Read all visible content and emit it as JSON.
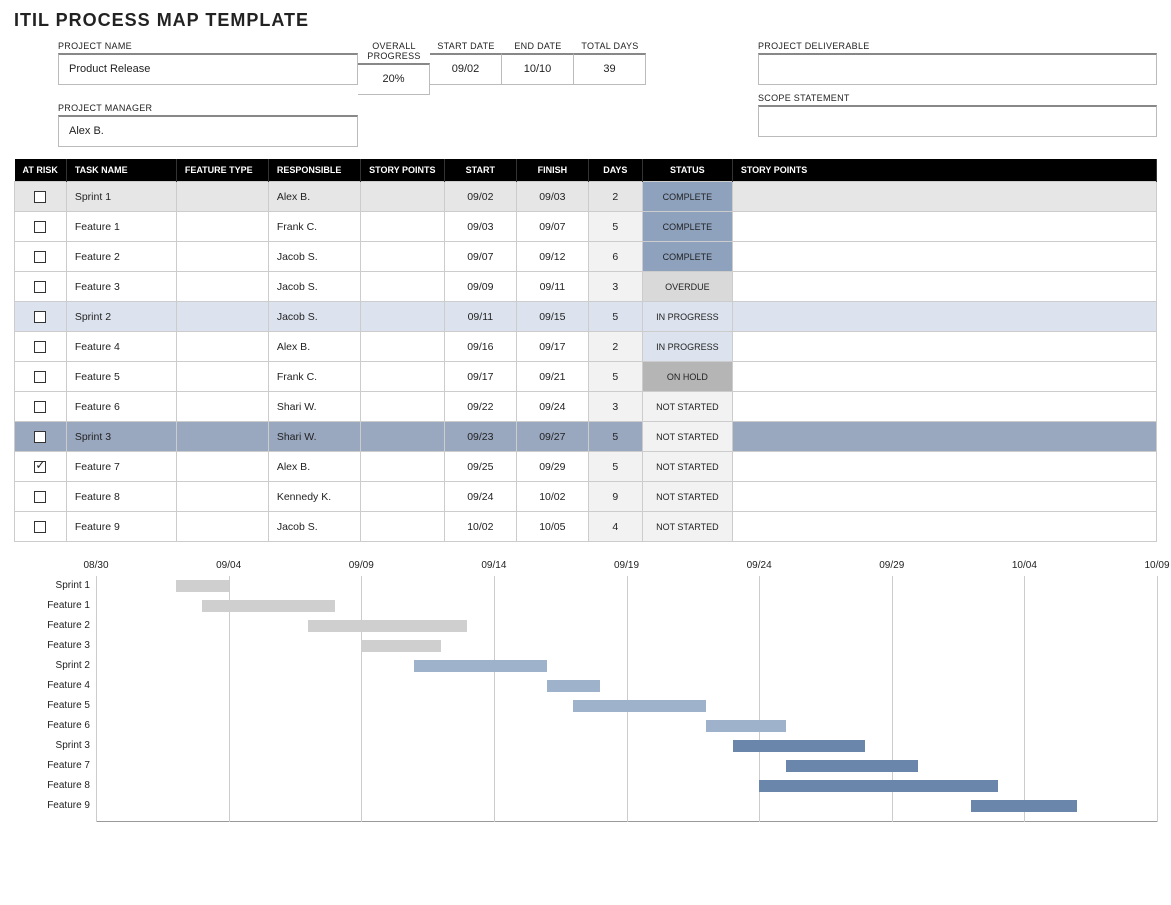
{
  "title": "ITIL PROCESS MAP TEMPLATE",
  "labels": {
    "project_name": "PROJECT NAME",
    "overall_progress": "OVERALL PROGRESS",
    "start_date": "START DATE",
    "end_date": "END DATE",
    "total_days": "TOTAL DAYS",
    "project_manager": "PROJECT MANAGER",
    "project_deliverable": "PROJECT DELIVERABLE",
    "scope_statement": "SCOPE STATEMENT"
  },
  "project": {
    "name": "Product Release",
    "overall_progress": "20%",
    "start_date": "09/02",
    "end_date": "10/10",
    "total_days": "39",
    "manager": "Alex B.",
    "deliverable": "",
    "scope": ""
  },
  "columns": {
    "at_risk": "AT RISK",
    "task_name": "TASK NAME",
    "feature_type": "FEATURE TYPE",
    "responsible": "RESPONSIBLE",
    "story_points": "STORY POINTS",
    "start": "START",
    "finish": "FINISH",
    "days": "DAYS",
    "status": "STATUS",
    "story_points2": "STORY POINTS"
  },
  "rows": [
    {
      "risk": false,
      "task": "Sprint 1",
      "ft": "",
      "resp": "Alex B.",
      "sp": "",
      "start": "09/02",
      "finish": "09/03",
      "days": "2",
      "status": "COMPLETE",
      "rowclass": "sprint1"
    },
    {
      "risk": false,
      "task": "Feature 1",
      "ft": "",
      "resp": "Frank C.",
      "sp": "",
      "start": "09/03",
      "finish": "09/07",
      "days": "5",
      "status": "COMPLETE",
      "rowclass": ""
    },
    {
      "risk": false,
      "task": "Feature 2",
      "ft": "",
      "resp": "Jacob S.",
      "sp": "",
      "start": "09/07",
      "finish": "09/12",
      "days": "6",
      "status": "COMPLETE",
      "rowclass": ""
    },
    {
      "risk": false,
      "task": "Feature 3",
      "ft": "",
      "resp": "Jacob S.",
      "sp": "",
      "start": "09/09",
      "finish": "09/11",
      "days": "3",
      "status": "OVERDUE",
      "rowclass": ""
    },
    {
      "risk": false,
      "task": "Sprint 2",
      "ft": "",
      "resp": "Jacob S.",
      "sp": "",
      "start": "09/11",
      "finish": "09/15",
      "days": "5",
      "status": "IN PROGRESS",
      "rowclass": "sprint2"
    },
    {
      "risk": false,
      "task": "Feature 4",
      "ft": "",
      "resp": "Alex B.",
      "sp": "",
      "start": "09/16",
      "finish": "09/17",
      "days": "2",
      "status": "IN PROGRESS",
      "rowclass": ""
    },
    {
      "risk": false,
      "task": "Feature 5",
      "ft": "",
      "resp": "Frank C.",
      "sp": "",
      "start": "09/17",
      "finish": "09/21",
      "days": "5",
      "status": "ON HOLD",
      "rowclass": ""
    },
    {
      "risk": false,
      "task": "Feature 6",
      "ft": "",
      "resp": "Shari W.",
      "sp": "",
      "start": "09/22",
      "finish": "09/24",
      "days": "3",
      "status": "NOT STARTED",
      "rowclass": ""
    },
    {
      "risk": false,
      "task": "Sprint 3",
      "ft": "",
      "resp": "Shari W.",
      "sp": "",
      "start": "09/23",
      "finish": "09/27",
      "days": "5",
      "status": "NOT STARTED",
      "rowclass": "sprint3"
    },
    {
      "risk": true,
      "task": "Feature 7",
      "ft": "",
      "resp": "Alex B.",
      "sp": "",
      "start": "09/25",
      "finish": "09/29",
      "days": "5",
      "status": "NOT STARTED",
      "rowclass": ""
    },
    {
      "risk": false,
      "task": "Feature 8",
      "ft": "",
      "resp": "Kennedy K.",
      "sp": "",
      "start": "09/24",
      "finish": "10/02",
      "days": "9",
      "status": "NOT STARTED",
      "rowclass": ""
    },
    {
      "risk": false,
      "task": "Feature 9",
      "ft": "",
      "resp": "Jacob S.",
      "sp": "",
      "start": "10/02",
      "finish": "10/05",
      "days": "4",
      "status": "NOT STARTED",
      "rowclass": ""
    }
  ],
  "status_class": {
    "COMPLETE": "st-COMPLETE",
    "OVERDUE": "st-OVERDUE",
    "IN PROGRESS": "st-INPROGRESS",
    "ON HOLD": "st-ONHOLD",
    "NOT STARTED": "st-NOTSTARTED"
  },
  "chart_data": {
    "type": "bar",
    "title": "",
    "xlabel": "",
    "ylabel": "",
    "axis_ticks": [
      "08/30",
      "09/04",
      "09/09",
      "09/14",
      "09/19",
      "09/24",
      "09/29",
      "10/04",
      "10/09"
    ],
    "axis_start_day": 0,
    "axis_end_day": 40,
    "origin": "08/30",
    "series": [
      {
        "name": "Sprint 1",
        "start_offset": 3,
        "duration": 2,
        "color": "c0"
      },
      {
        "name": "Feature 1",
        "start_offset": 4,
        "duration": 5,
        "color": "c0"
      },
      {
        "name": "Feature 2",
        "start_offset": 8,
        "duration": 6,
        "color": "c0"
      },
      {
        "name": "Feature 3",
        "start_offset": 10,
        "duration": 3,
        "color": "c0"
      },
      {
        "name": "Sprint 2",
        "start_offset": 12,
        "duration": 5,
        "color": "c1"
      },
      {
        "name": "Feature 4",
        "start_offset": 17,
        "duration": 2,
        "color": "c1"
      },
      {
        "name": "Feature 5",
        "start_offset": 18,
        "duration": 5,
        "color": "c1"
      },
      {
        "name": "Feature 6",
        "start_offset": 23,
        "duration": 3,
        "color": "c1"
      },
      {
        "name": "Sprint 3",
        "start_offset": 24,
        "duration": 5,
        "color": "c2"
      },
      {
        "name": "Feature 7",
        "start_offset": 26,
        "duration": 5,
        "color": "c2"
      },
      {
        "name": "Feature 8",
        "start_offset": 25,
        "duration": 9,
        "color": "c2"
      },
      {
        "name": "Feature 9",
        "start_offset": 33,
        "duration": 4,
        "color": "c2"
      }
    ]
  }
}
